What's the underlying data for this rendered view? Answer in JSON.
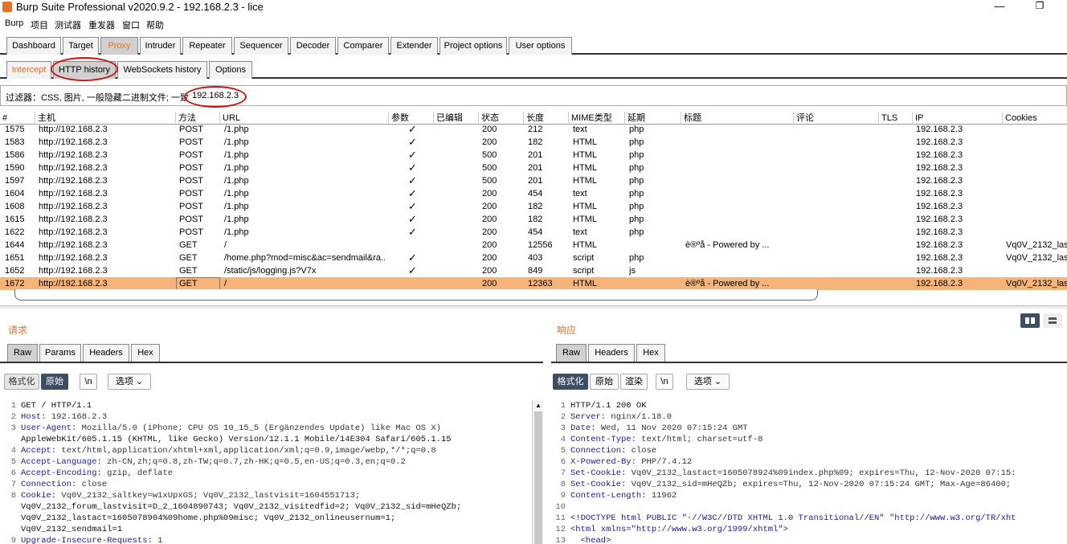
{
  "window": {
    "title": "Burp Suite Professional v2020.9.2 - 192.168.2.3 - lice",
    "min_glyph": "—",
    "max_glyph": "❐"
  },
  "menu": [
    "Burp",
    "项目",
    "测试器",
    "重发器",
    "窗口",
    "帮助"
  ],
  "main_tabs": [
    "Dashboard",
    "Target",
    "Proxy",
    "Intruder",
    "Repeater",
    "Sequencer",
    "Decoder",
    "Comparer",
    "Extender",
    "Project options",
    "User options"
  ],
  "sub_tabs": [
    "Intercept",
    "HTTP history",
    "WebSockets history",
    "Options"
  ],
  "filter": {
    "text": "过滤器：CSS, 图片, 一般隐藏二进制文件; 一致",
    "value": "192.168.2.3"
  },
  "table": {
    "columns": [
      "#",
      "主机",
      "方法",
      "URL",
      "参数",
      "已编辑",
      "状态",
      "长度",
      "MIME类型",
      "延期",
      "标题",
      "评论",
      "TLS",
      "IP",
      "Cookies"
    ],
    "rows": [
      {
        "id": "1575",
        "host": "http://192.168.2.3",
        "method": "POST",
        "url": "/1.php",
        "params": "✓",
        "status": "200",
        "length": "212",
        "mime": "text",
        "ext": "php",
        "title": "",
        "ip": "192.168.2.3",
        "cookies": ""
      },
      {
        "id": "1583",
        "host": "http://192.168.2.3",
        "method": "POST",
        "url": "/1.php",
        "params": "✓",
        "status": "200",
        "length": "182",
        "mime": "HTML",
        "ext": "php",
        "title": "",
        "ip": "192.168.2.3",
        "cookies": ""
      },
      {
        "id": "1586",
        "host": "http://192.168.2.3",
        "method": "POST",
        "url": "/1.php",
        "params": "✓",
        "status": "500",
        "length": "201",
        "mime": "HTML",
        "ext": "php",
        "title": "",
        "ip": "192.168.2.3",
        "cookies": ""
      },
      {
        "id": "1590",
        "host": "http://192.168.2.3",
        "method": "POST",
        "url": "/1.php",
        "params": "✓",
        "status": "500",
        "length": "201",
        "mime": "HTML",
        "ext": "php",
        "title": "",
        "ip": "192.168.2.3",
        "cookies": ""
      },
      {
        "id": "1597",
        "host": "http://192.168.2.3",
        "method": "POST",
        "url": "/1.php",
        "params": "✓",
        "status": "500",
        "length": "201",
        "mime": "HTML",
        "ext": "php",
        "title": "",
        "ip": "192.168.2.3",
        "cookies": ""
      },
      {
        "id": "1604",
        "host": "http://192.168.2.3",
        "method": "POST",
        "url": "/1.php",
        "params": "✓",
        "status": "200",
        "length": "454",
        "mime": "text",
        "ext": "php",
        "title": "",
        "ip": "192.168.2.3",
        "cookies": ""
      },
      {
        "id": "1608",
        "host": "http://192.168.2.3",
        "method": "POST",
        "url": "/1.php",
        "params": "✓",
        "status": "200",
        "length": "182",
        "mime": "HTML",
        "ext": "php",
        "title": "",
        "ip": "192.168.2.3",
        "cookies": ""
      },
      {
        "id": "1615",
        "host": "http://192.168.2.3",
        "method": "POST",
        "url": "/1.php",
        "params": "✓",
        "status": "200",
        "length": "182",
        "mime": "HTML",
        "ext": "php",
        "title": "",
        "ip": "192.168.2.3",
        "cookies": ""
      },
      {
        "id": "1622",
        "host": "http://192.168.2.3",
        "method": "POST",
        "url": "/1.php",
        "params": "✓",
        "status": "200",
        "length": "454",
        "mime": "text",
        "ext": "php",
        "title": "",
        "ip": "192.168.2.3",
        "cookies": ""
      },
      {
        "id": "1644",
        "host": "http://192.168.2.3",
        "method": "GET",
        "url": "/",
        "params": "",
        "status": "200",
        "length": "12556",
        "mime": "HTML",
        "ext": "",
        "title": "è®ºå  - Powered by ...",
        "ip": "192.168.2.3",
        "cookies": "Vq0V_2132_las"
      },
      {
        "id": "1651",
        "host": "http://192.168.2.3",
        "method": "GET",
        "url": "/home.php?mod=misc&ac=sendmail&ra...",
        "params": "✓",
        "status": "200",
        "length": "403",
        "mime": "script",
        "ext": "php",
        "title": "",
        "ip": "192.168.2.3",
        "cookies": "Vq0V_2132_las"
      },
      {
        "id": "1652",
        "host": "http://192.168.2.3",
        "method": "GET",
        "url": "/static/js/logging.js?V7x",
        "params": "✓",
        "status": "200",
        "length": "849",
        "mime": "script",
        "ext": "js",
        "title": "",
        "ip": "192.168.2.3",
        "cookies": ""
      },
      {
        "id": "1672",
        "host": "http://192.168.2.3",
        "method": "GET",
        "url": "/",
        "params": "",
        "status": "200",
        "length": "12363",
        "mime": "HTML",
        "ext": "",
        "title": "è®ºå  - Powered by ...",
        "ip": "192.168.2.3",
        "cookies": "Vq0V_2132_las"
      }
    ],
    "selected_row": "1672"
  },
  "request": {
    "label": "请求",
    "tabs": [
      "Raw",
      "Params",
      "Headers",
      "Hex"
    ],
    "toolbar": {
      "pretty": "格式化",
      "raw": "原始",
      "newline": "\\n",
      "options": "选项 ⌄"
    },
    "lines": [
      {
        "n": "1",
        "text": "GET / HTTP/1.1"
      },
      {
        "n": "2",
        "text": "Host: 192.168.2.3"
      },
      {
        "n": "3",
        "text": "User-Agent: Mozilla/5.0 (iPhone; CPU OS 10_15_5 (Ergänzendes Update) like Mac OS X)"
      },
      {
        "n": "",
        "text": "AppleWebKit/605.1.15 (KHTML, like Gecko) Version/12.1.1 Mobile/14E304 Safari/605.1.15"
      },
      {
        "n": "4",
        "text": "Accept: text/html,application/xhtml+xml,application/xml;q=0.9,image/webp,*/*;q=0.8"
      },
      {
        "n": "5",
        "text": "Accept-Language: zh-CN,zh;q=0.8,zh-TW;q=0.7,zh-HK;q=0.5,en-US;q=0.3,en;q=0.2"
      },
      {
        "n": "6",
        "text": "Accept-Encoding: gzip, deflate"
      },
      {
        "n": "7",
        "text": "Connection: close"
      },
      {
        "n": "8",
        "text": "Cookie: Vq0V_2132_saltkey=w1xUpxGS; Vq0V_2132_lastvisit=1604551713;"
      },
      {
        "n": "",
        "text": "Vq0V_2132_forum_lastvisit=D_2_1604890743; Vq0V_2132_visitedfid=2; Vq0V_2132_sid=mHeQZb;"
      },
      {
        "n": "",
        "text": "Vq0V_2132_lastact=1605078904%09home.php%09misc; Vq0V_2132_onlineusernum=1;"
      },
      {
        "n": "",
        "text": "Vq0V_2132_sendmail=1"
      },
      {
        "n": "9",
        "text": "Upgrade-Insecure-Requests: 1"
      }
    ]
  },
  "response": {
    "label": "响应",
    "tabs": [
      "Raw",
      "Headers",
      "Hex"
    ],
    "toolbar": {
      "pretty": "格式化",
      "raw": "原始",
      "render": "渲染",
      "newline": "\\n",
      "options": "选项 ⌄"
    },
    "lines": [
      {
        "n": "1",
        "text": "HTTP/1.1 200 OK"
      },
      {
        "n": "2",
        "text": "Server: nginx/1.18.0"
      },
      {
        "n": "3",
        "text": "Date: Wed, 11 Nov 2020 07:15:24 GMT"
      },
      {
        "n": "4",
        "text": "Content-Type: text/html; charset=utf-8"
      },
      {
        "n": "5",
        "text": "Connection: close"
      },
      {
        "n": "6",
        "text": "X-Powered-By: PHP/7.4.12"
      },
      {
        "n": "7",
        "text": "Set-Cookie: Vq0V_2132_lastact=1605078924%09index.php%09; expires=Thu, 12-Nov-2020 07:15:"
      },
      {
        "n": "8",
        "text": "Set-Cookie: Vq0V_2132_sid=mHeQZb; expires=Thu, 12-Nov-2020 07:15:24 GMT; Max-Age=86400;"
      },
      {
        "n": "9",
        "text": "Content-Length: 11962"
      },
      {
        "n": "10",
        "text": ""
      },
      {
        "n": "11",
        "text": "<!DOCTYPE html PUBLIC \"-//W3C//DTD XHTML 1.0 Transitional//EN\" \"http://www.w3.org/TR/xht"
      },
      {
        "n": "12",
        "text": "<html xmlns=\"http://www.w3.org/1999/xhtml\">"
      },
      {
        "n": "13",
        "text": "  <head>"
      }
    ]
  },
  "colors": {
    "accent": "#e8702a",
    "selected_row": "#f5b47a",
    "toolbar_dark": "#3c4e63",
    "annotation": "#d01010"
  }
}
